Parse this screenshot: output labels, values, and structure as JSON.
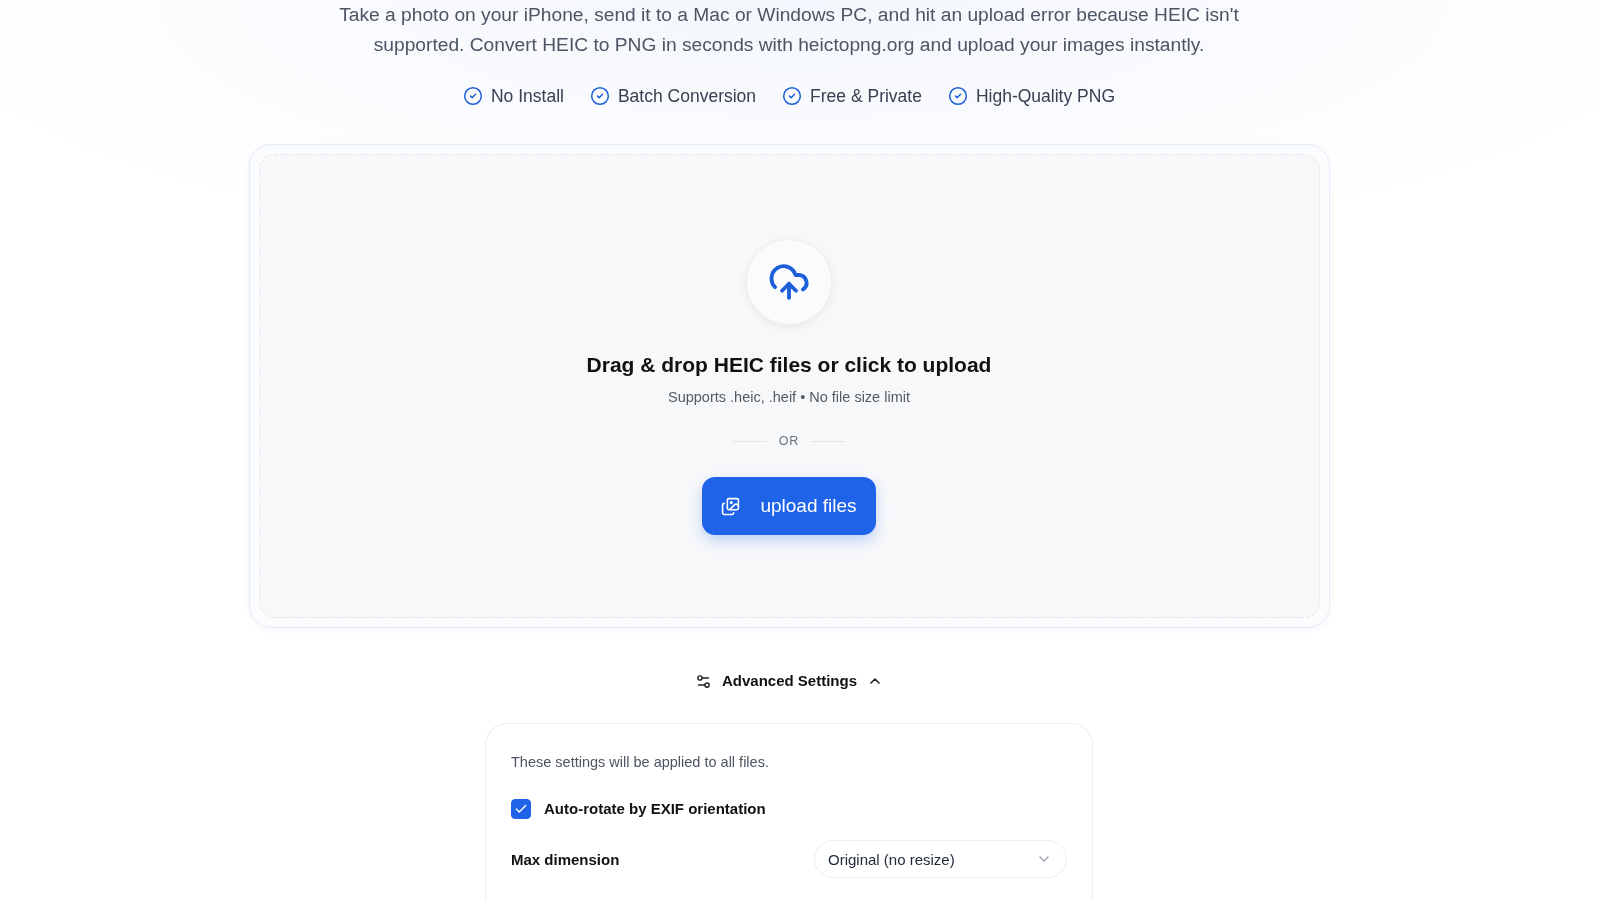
{
  "intro": {
    "text": "Take a photo on your iPhone, send it to a Mac or Windows PC, and hit an upload error because HEIC isn't supported. Convert HEIC to PNG in seconds with heictopng.org and upload your images instantly."
  },
  "features": [
    {
      "label": "No Install"
    },
    {
      "label": "Batch Conversion"
    },
    {
      "label": "Free & Private"
    },
    {
      "label": "High-Quality PNG"
    }
  ],
  "dropzone": {
    "heading": "Drag & drop HEIC files or click to upload",
    "subtext": "Supports .heic, .heif • No file size limit",
    "divider": "OR",
    "button": "upload files"
  },
  "advanced_settings": {
    "label": "Advanced Settings",
    "expanded": true,
    "note": "These settings will be applied to all files.",
    "auto_rotate": {
      "label": "Auto-rotate by EXIF orientation",
      "checked": true
    },
    "max_dimension": {
      "label": "Max dimension",
      "value": "Original (no resize)"
    }
  }
}
